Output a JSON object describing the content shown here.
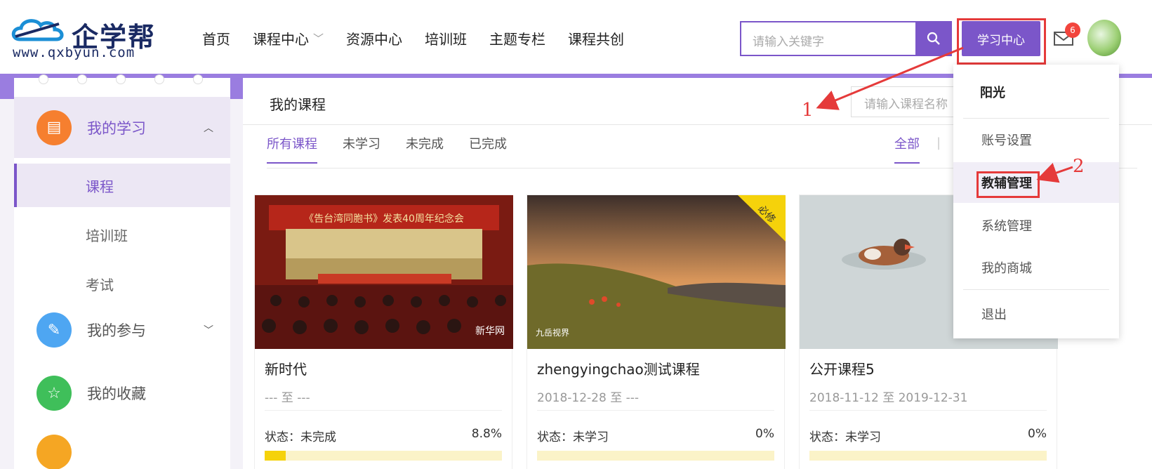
{
  "header": {
    "logo_text": "企学帮",
    "logo_url": "www.qxbyun.com",
    "nav": [
      {
        "label": "首页"
      },
      {
        "label": "课程中心"
      },
      {
        "label": "资源中心"
      },
      {
        "label": "培训班"
      },
      {
        "label": "主题专栏"
      },
      {
        "label": "课程共创"
      }
    ],
    "search_placeholder": "请输入关键字",
    "study_center": "学习中心",
    "message_count": "6"
  },
  "sidebar": {
    "my_study": "我的学习",
    "items": [
      {
        "label": "课程"
      },
      {
        "label": "培训班"
      },
      {
        "label": "考试"
      }
    ],
    "my_participation": "我的参与",
    "my_favorites": "我的收藏"
  },
  "main": {
    "title": "我的课程",
    "search_placeholder": "请输入课程名称",
    "tabs": [
      {
        "label": "所有课程"
      },
      {
        "label": "未学习"
      },
      {
        "label": "未完成"
      },
      {
        "label": "已完成"
      }
    ],
    "filter_all": "全部",
    "filter_sep": "|",
    "courses": [
      {
        "title": "新时代",
        "date": "--- 至 ---",
        "status": "状态：未完成",
        "percent": "8.8%",
        "progress": 0.088,
        "image_caption": "《告台湾同胞书》发表40周年纪念会",
        "watermark": "新华网"
      },
      {
        "title": "zhengyingchao测试课程",
        "date": "2018-12-28 至 ---",
        "status": "状态：未学习",
        "percent": "0%",
        "progress": 0,
        "ribbon": "必修",
        "watermark": "九岳视界"
      },
      {
        "title": "公开课程5",
        "date": "2018-11-12 至 2019-12-31",
        "status": "状态：未学习",
        "percent": "0%",
        "progress": 0
      }
    ]
  },
  "dropdown": {
    "user_name": "阳光",
    "items": [
      {
        "label": "账号设置"
      },
      {
        "label": "教辅管理"
      },
      {
        "label": "系统管理"
      },
      {
        "label": "我的商城"
      }
    ],
    "logout": "退出"
  },
  "annotations": {
    "step1": "1",
    "step2": "2"
  },
  "colors": {
    "accent": "#7b56c9",
    "annotation": "#e53a3a",
    "progress": "#f5d20b"
  }
}
